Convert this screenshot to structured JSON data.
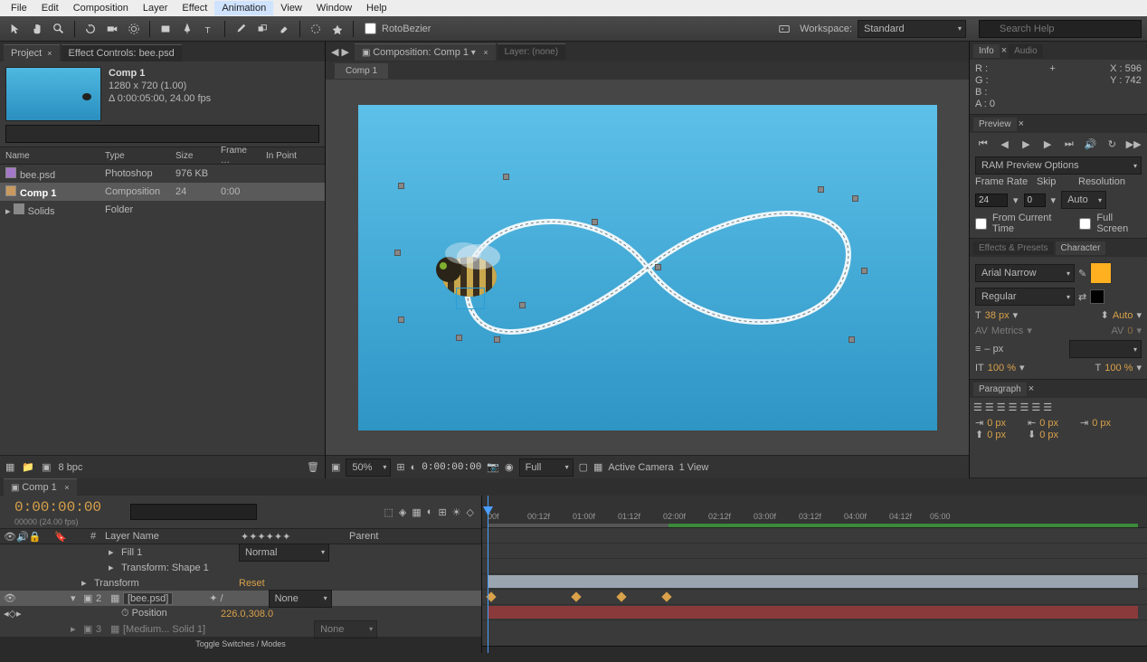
{
  "menu": {
    "items": [
      "File",
      "Edit",
      "Composition",
      "Layer",
      "Effect",
      "Animation",
      "View",
      "Window",
      "Help"
    ],
    "hover_index": 5
  },
  "toolbar": {
    "roto": "RotoBezier",
    "workspace_label": "Workspace:",
    "workspace": "Standard",
    "search_ph": "Search Help"
  },
  "project": {
    "tab": "Project",
    "tab2": "Effect Controls: bee.psd",
    "comp_name": "Comp 1",
    "dims": "1280 x 720 (1.00)",
    "dur": "Δ 0:00:05:00, 24.00 fps",
    "cols": {
      "name": "Name",
      "type": "Type",
      "size": "Size",
      "frame": "Frame …",
      "inpoint": "In Point"
    },
    "rows": [
      {
        "name": "bee.psd",
        "type": "Photoshop",
        "size": "976 KB"
      },
      {
        "name": "Comp 1",
        "type": "Composition",
        "size": "24",
        "frame": "0:00"
      },
      {
        "name": "Solids",
        "type": "Folder"
      }
    ],
    "bpc": "8 bpc"
  },
  "comp": {
    "tab": "Composition: Comp 1",
    "layer_tab": "Layer: (none)",
    "subtab": "Comp 1",
    "zoom": "50%",
    "timecode": "0:00:00:00",
    "res": "Full",
    "camera": "Active Camera",
    "views": "1 View"
  },
  "info": {
    "tab": "Info",
    "tab2": "Audio",
    "r": "R :",
    "g": "G :",
    "b": "B :",
    "a": "A : 0",
    "x": "X : 596",
    "y": "Y : 742"
  },
  "preview": {
    "tab": "Preview",
    "ram": "RAM Preview Options",
    "fr_l": "Frame Rate",
    "skip_l": "Skip",
    "res_l": "Resolution",
    "fr": "24",
    "skip": "0",
    "res": "Auto",
    "from": "From Current Time",
    "full": "Full Screen"
  },
  "effects_tab": "Effects & Presets",
  "char_tab": "Character",
  "char": {
    "font": "Arial Narrow",
    "style": "Regular",
    "size": "38 px",
    "auto": "Auto",
    "metrics": "Metrics",
    "zero": "0",
    "dash": "– px",
    "pct1": "100 %",
    "pct2": "100 %"
  },
  "para": {
    "tab": "Paragraph",
    "px": "0 px"
  },
  "timeline": {
    "tab": "Comp 1",
    "time": "0:00:00:00",
    "frames": "00000 (24.00 fps)",
    "hdr": {
      "num": "#",
      "layer": "Layer Name",
      "parent": "Parent"
    },
    "ticks": [
      "00f",
      "00:12f",
      "01:00f",
      "01:12f",
      "02:00f",
      "02:12f",
      "03:00f",
      "03:12f",
      "04:00f",
      "04:12f",
      "05:00"
    ],
    "rows": [
      {
        "indent": 3,
        "label": "Fill 1",
        "mode": "Normal"
      },
      {
        "indent": 3,
        "label": "Transform: Shape 1"
      },
      {
        "indent": 2,
        "label": "Reset",
        "pre": "Transform",
        "orange": true
      },
      {
        "num": "2",
        "layer": "[bee.psd]",
        "parent": "None",
        "sel": true
      },
      {
        "indent": 3,
        "label": "Position",
        "val": "226.0,308.0",
        "orange": true,
        "kf": true
      },
      {
        "num": "3",
        "layer": "[Medium... Solid 1]",
        "parent": "None",
        "dim": true
      }
    ],
    "toggle": "Toggle Switches / Modes"
  }
}
